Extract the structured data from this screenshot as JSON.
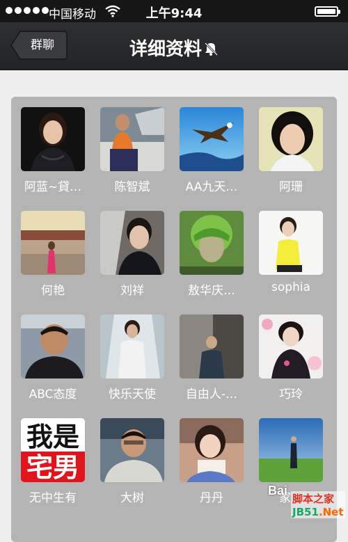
{
  "status_bar": {
    "carrier": "中国移动",
    "time": "上午9:44"
  },
  "nav": {
    "back_label": "群聊",
    "title": "详细资料"
  },
  "members": [
    {
      "name": "阿蓝~貸…",
      "avatar": "woman-dark-dress"
    },
    {
      "name": "陈智斌",
      "avatar": "man-on-boat"
    },
    {
      "name": "AA九天…",
      "avatar": "eagle-sky"
    },
    {
      "name": "阿珊",
      "avatar": "woman-portrait"
    },
    {
      "name": "何艳",
      "avatar": "woman-red-dress"
    },
    {
      "name": "刘祥",
      "avatar": "man-in-car"
    },
    {
      "name": "敖华庆…",
      "avatar": "green-hair-person"
    },
    {
      "name": "sophia",
      "avatar": "woman-yellow-top"
    },
    {
      "name": "ABC态度",
      "avatar": "man-portrait"
    },
    {
      "name": "快乐天使",
      "avatar": "woman-white-dress"
    },
    {
      "name": "自由人-…",
      "avatar": "man-by-wall"
    },
    {
      "name": "巧玲",
      "avatar": "woman-floral"
    },
    {
      "name": "无中生有",
      "avatar": "text-logo"
    },
    {
      "name": "大树",
      "avatar": "man-glasses"
    },
    {
      "name": "丹丹",
      "avatar": "woman-with-sign"
    },
    {
      "name": "家…",
      "avatar": "man-on-grass"
    }
  ],
  "avatar_texts": {
    "text_logo_line1": "我是",
    "text_logo_line2": "宅男"
  },
  "watermark": {
    "baidu": "Bai",
    "jb51": "脚本之家",
    "jb51_domain": "JB51",
    "jb51_tld": ".Net"
  }
}
